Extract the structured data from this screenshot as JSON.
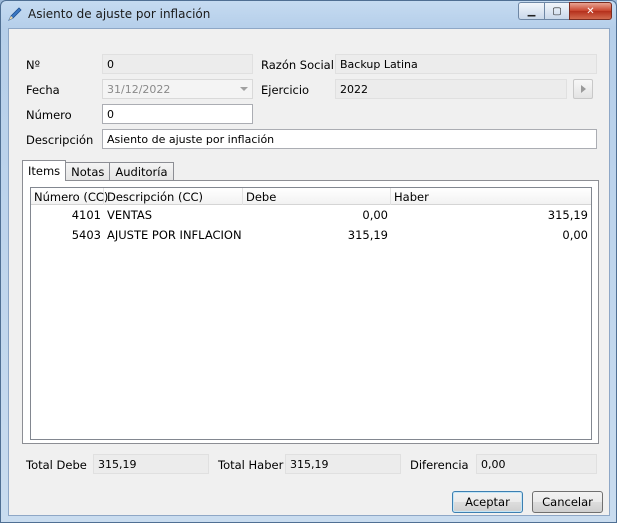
{
  "window": {
    "title": "Asiento de ajuste por inflación"
  },
  "titlebar_buttons": {
    "minimize": "▁",
    "maximize": "▢",
    "close": "✕"
  },
  "form": {
    "nro_label": "Nº",
    "nro_value": "0",
    "razon_social_label": "Razón Social",
    "razon_social_value": "Backup Latina",
    "fecha_label": "Fecha",
    "fecha_value": "31/12/2022",
    "ejercicio_label": "Ejercicio",
    "ejercicio_value": "2022",
    "numero_label": "Número",
    "numero_value": "0",
    "descripcion_label": "Descripción",
    "descripcion_value": "Asiento de ajuste por inflación"
  },
  "tabs": [
    {
      "label": "Items"
    },
    {
      "label": "Notas"
    },
    {
      "label": "Auditoría"
    }
  ],
  "grid": {
    "columns": [
      "Número (CC)",
      "Descripción (CC)",
      "Debe",
      "Haber"
    ],
    "rows": [
      {
        "numero": "4101",
        "descripcion": "VENTAS",
        "debe": "0,00",
        "haber": "315,19"
      },
      {
        "numero": "5403",
        "descripcion": "AJUSTE POR INFLACION",
        "debe": "315,19",
        "haber": "0,00"
      }
    ]
  },
  "totals": {
    "total_debe_label": "Total Debe",
    "total_debe_value": "315,19",
    "total_haber_label": "Total Haber",
    "total_haber_value": "315,19",
    "diferencia_label": "Diferencia",
    "diferencia_value": "0,00"
  },
  "buttons": {
    "aceptar": "Aceptar",
    "cancelar": "Cancelar"
  }
}
